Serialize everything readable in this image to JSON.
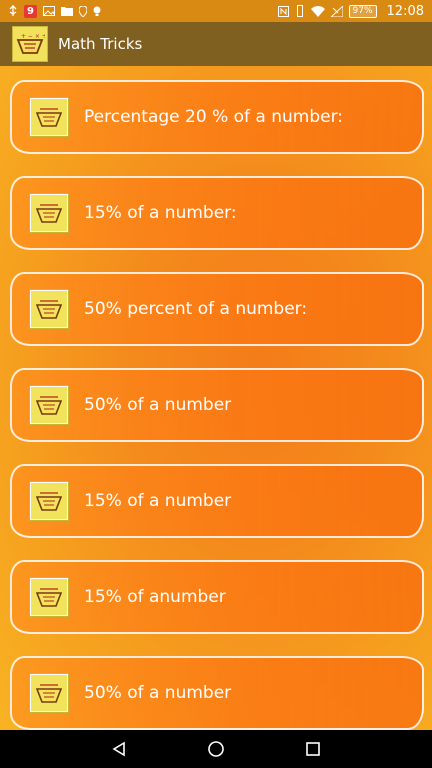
{
  "status_bar": {
    "notification_badge": "9",
    "battery": "97%",
    "time": "12:08"
  },
  "app_bar": {
    "title": "Math Tricks",
    "logo_icon": "math-tricks-logo-icon"
  },
  "list": {
    "items": [
      {
        "label": "Percentage 20 % of a number:",
        "icon": "math-tricks-thumbnail-icon"
      },
      {
        "label": "15% of a number:",
        "icon": "math-tricks-thumbnail-icon"
      },
      {
        "label": "50% percent of a number:",
        "icon": "math-tricks-thumbnail-icon"
      },
      {
        "label": "50% of a number",
        "icon": "math-tricks-thumbnail-icon"
      },
      {
        "label": "15% of a number",
        "icon": "math-tricks-thumbnail-icon"
      },
      {
        "label": "15% of anumber",
        "icon": "math-tricks-thumbnail-icon"
      },
      {
        "label": "50% of a number",
        "icon": "math-tricks-thumbnail-icon"
      }
    ]
  },
  "colors": {
    "app_bar": "#806021",
    "background": "#f48a1c",
    "text": "#ffffff"
  }
}
